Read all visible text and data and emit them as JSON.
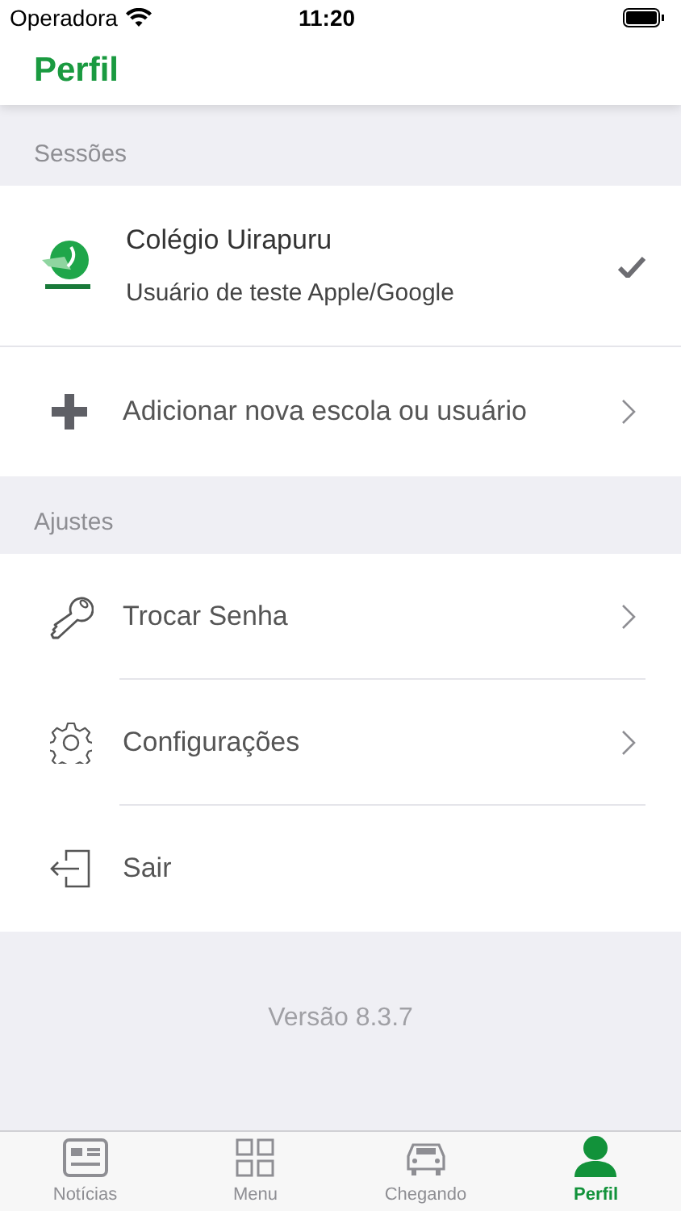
{
  "status_bar": {
    "carrier": "Operadora",
    "time": "11:20"
  },
  "nav": {
    "title": "Perfil"
  },
  "sessions": {
    "header": "Sessões",
    "items": [
      {
        "title": "Colégio Uirapuru",
        "subtitle": "Usuário de teste Apple/Google",
        "selected": true
      }
    ],
    "add": {
      "label": "Adicionar nova escola ou usuário"
    }
  },
  "settings": {
    "header": "Ajustes",
    "items": [
      {
        "kind": "key",
        "label": "Trocar Senha",
        "chevron": true
      },
      {
        "kind": "gear",
        "label": "Configurações",
        "chevron": true
      },
      {
        "kind": "exit",
        "label": "Sair",
        "chevron": false
      }
    ]
  },
  "version": "Versão 8.3.7",
  "tabs": [
    {
      "kind": "news",
      "label": "Notícias",
      "selected": false
    },
    {
      "kind": "grid",
      "label": "Menu",
      "selected": false
    },
    {
      "kind": "car",
      "label": "Chegando",
      "selected": false
    },
    {
      "kind": "person",
      "label": "Perfil",
      "selected": true
    }
  ]
}
